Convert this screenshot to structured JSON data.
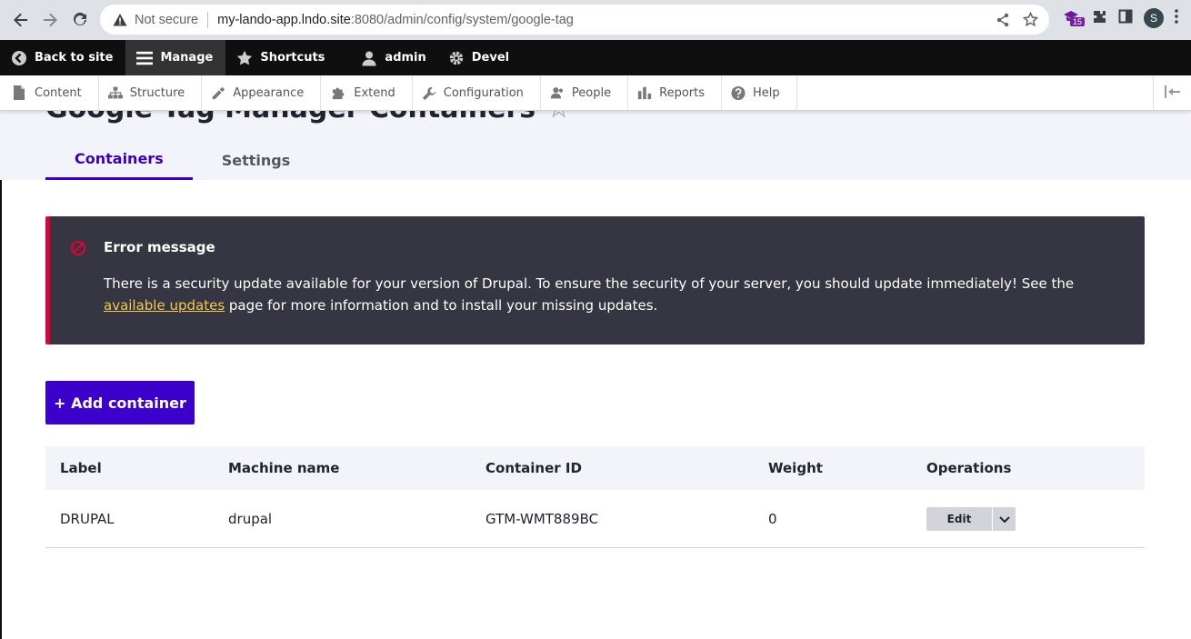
{
  "browser": {
    "security_label": "Not secure",
    "url_host": "my-lando-app.lndo.site",
    "url_rest": ":8080/admin/config/system/google-tag",
    "extension_badge": "15",
    "profile_initial": "S"
  },
  "toolbar": {
    "back": "Back to site",
    "manage": "Manage",
    "shortcuts": "Shortcuts",
    "user": "admin",
    "devel": "Devel"
  },
  "tray": {
    "items": [
      "Content",
      "Structure",
      "Appearance",
      "Extend",
      "Configuration",
      "People",
      "Reports",
      "Help"
    ]
  },
  "page": {
    "title": "Google Tag Manager Containers",
    "tabs": [
      "Containers",
      "Settings"
    ]
  },
  "message": {
    "title": "Error message",
    "body_before": "There is a security update available for your version of Drupal. To ensure the security of your server, you should update immediately! See the ",
    "link": "available updates",
    "body_after": " page for more information and to install your missing updates."
  },
  "add_button": "+ Add container",
  "table": {
    "headers": [
      "Label",
      "Machine name",
      "Container ID",
      "Weight",
      "Operations"
    ],
    "rows": [
      {
        "label": "DRUPAL",
        "machine_name": "drupal",
        "container_id": "GTM-WMT889BC",
        "weight": "0",
        "op": "Edit"
      }
    ]
  },
  "colors": {
    "accent": "#3b00c9",
    "error_border": "#e00037",
    "message_bg": "#353641",
    "link": "#f2c94c"
  }
}
